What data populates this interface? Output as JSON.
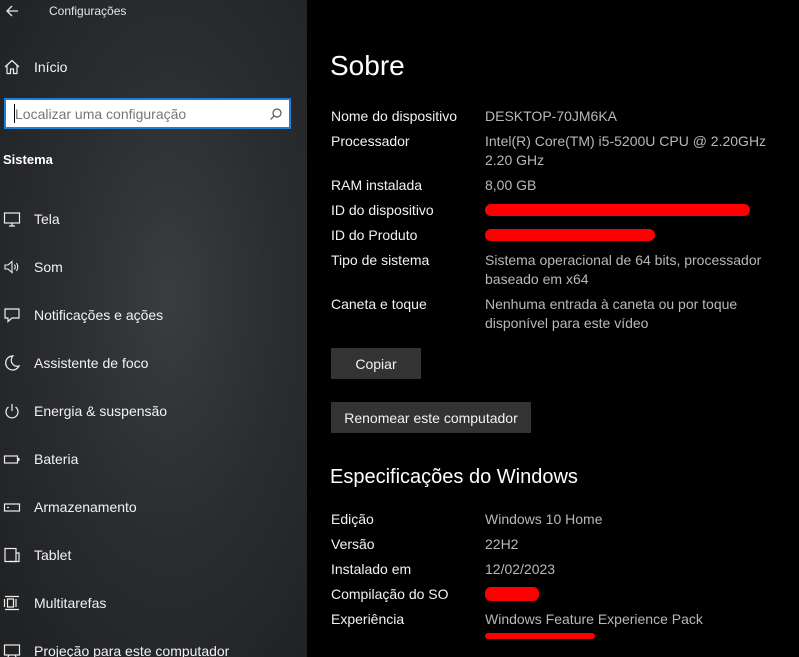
{
  "window": {
    "title": "Configurações"
  },
  "sidebar": {
    "home_label": "Início",
    "search": {
      "placeholder": "Localizar uma configuração",
      "value": ""
    },
    "section": "Sistema",
    "items": [
      {
        "label": "Tela",
        "icon": "monitor-icon"
      },
      {
        "label": "Som",
        "icon": "speaker-icon"
      },
      {
        "label": "Notificações e ações",
        "icon": "message-icon"
      },
      {
        "label": "Assistente de foco",
        "icon": "moon-icon"
      },
      {
        "label": "Energia & suspensão",
        "icon": "power-icon"
      },
      {
        "label": "Bateria",
        "icon": "battery-icon"
      },
      {
        "label": "Armazenamento",
        "icon": "storage-icon"
      },
      {
        "label": "Tablet",
        "icon": "tablet-icon"
      },
      {
        "label": "Multitarefas",
        "icon": "multitask-icon"
      },
      {
        "label": "Projeção para este computador",
        "icon": "projection-icon"
      }
    ]
  },
  "about": {
    "title": "Sobre",
    "specs": [
      {
        "label": "Nome do dispositivo",
        "value": "DESKTOP-70JM6KA"
      },
      {
        "label": "Processador",
        "value": "Intel(R) Core(TM) i5-5200U CPU @ 2.20GHz 2.20 GHz"
      },
      {
        "label": "RAM instalada",
        "value": "8,00 GB"
      },
      {
        "label": "ID do dispositivo",
        "value": ""
      },
      {
        "label": "ID do Produto",
        "value": ""
      },
      {
        "label": "Tipo de sistema",
        "value": "Sistema operacional de 64 bits, processador baseado em x64"
      },
      {
        "label": "Caneta e toque",
        "value": "Nenhuma entrada à caneta ou por toque disponível para este vídeo"
      }
    ],
    "copy_button": "Copiar",
    "rename_button": "Renomear este computador"
  },
  "windows_specs": {
    "title": "Especificações do Windows",
    "specs": [
      {
        "label": "Edição",
        "value": "Windows 10 Home"
      },
      {
        "label": "Versão",
        "value": "22H2"
      },
      {
        "label": "Instalado em",
        "value": "12/02/2023"
      },
      {
        "label": "Compilação do SO",
        "value": ""
      },
      {
        "label": "Experiência",
        "value": "Windows Feature Experience Pack"
      }
    ]
  },
  "colors": {
    "redaction": "#ff0000",
    "accent": "#1d7fd6",
    "button_bg": "#333333"
  }
}
